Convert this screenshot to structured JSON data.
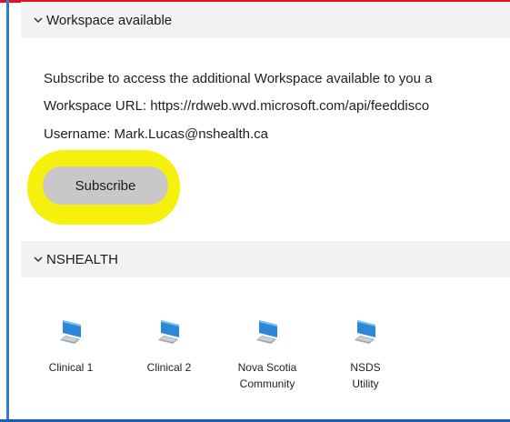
{
  "workspace_section": {
    "title": "Workspace available",
    "description": "Subscribe to access the additional Workspace available to you a",
    "workspace_url": "Workspace URL: https://rdweb.wvd.microsoft.com/api/feeddisco",
    "username": "Username: Mark.Lucas@nshealth.ca",
    "subscribe_label": "Subscribe"
  },
  "nshealth_section": {
    "title": "NSHEALTH",
    "apps": [
      {
        "label": "Clinical 1",
        "icon": "remote-desktop-icon"
      },
      {
        "label": "Clinical 2",
        "icon": "remote-desktop-icon"
      },
      {
        "label": "Nova Scotia Community",
        "icon": "remote-desktop-icon"
      },
      {
        "label": "NSDS Utility",
        "icon": "remote-desktop-icon"
      }
    ]
  },
  "colors": {
    "top_border": "#e81123",
    "left_accent": "#2b7cd3",
    "highlight": "#f5f10d",
    "button": "#c8c8c8",
    "section_header": "#f2f2f2"
  }
}
